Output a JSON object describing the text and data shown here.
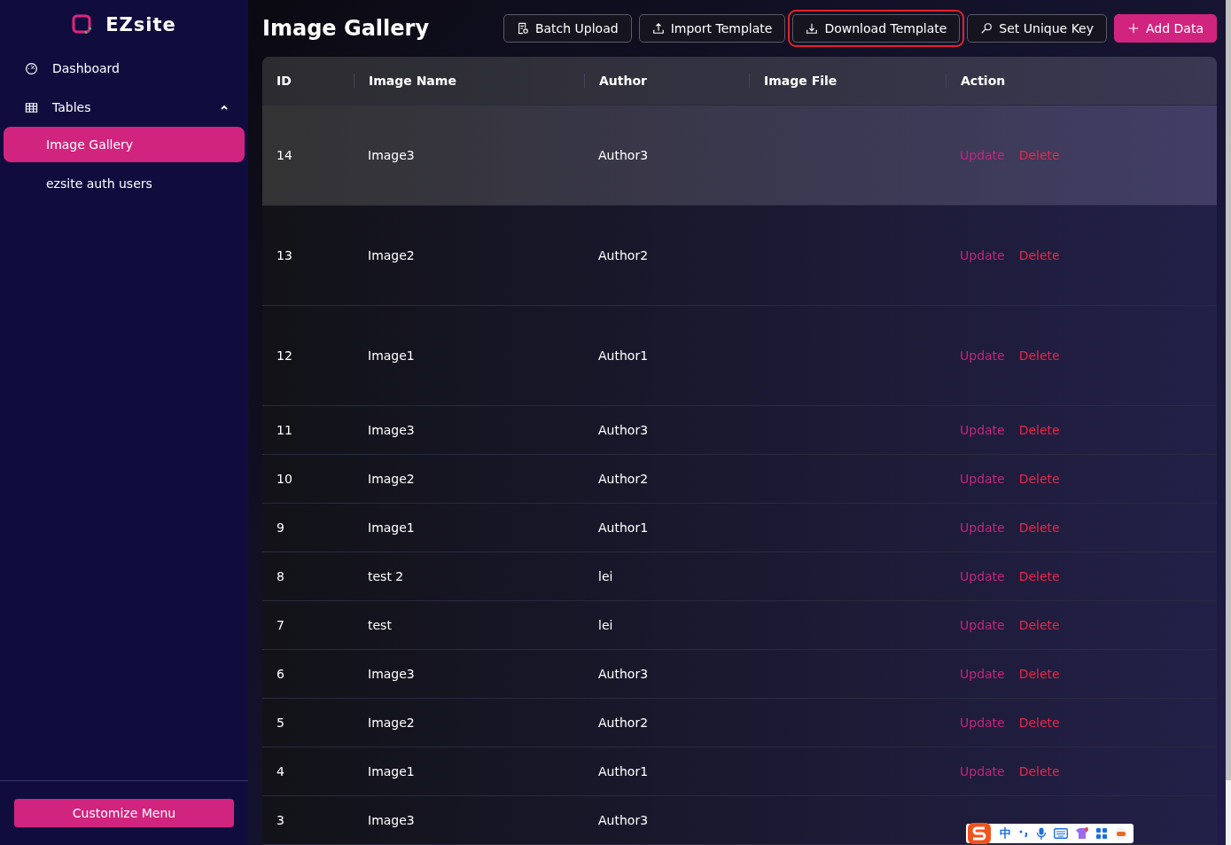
{
  "sidebar": {
    "logo": "EZsite",
    "items": [
      {
        "label": "Dashboard",
        "kind": "gauge"
      },
      {
        "label": "Tables",
        "kind": "grid",
        "expanded": true,
        "children": [
          {
            "label": "Image Gallery",
            "selected": true
          },
          {
            "label": "ezsite auth users",
            "selected": false
          }
        ]
      }
    ],
    "footer_button": "Customize Menu"
  },
  "header": {
    "title": "Image Gallery",
    "buttons": [
      {
        "label": "Batch Upload",
        "kind": "doc",
        "primary": false,
        "outlined_red": false
      },
      {
        "label": "Import Template",
        "kind": "upload",
        "primary": false,
        "outlined_red": false
      },
      {
        "label": "Download Template",
        "kind": "download",
        "primary": false,
        "outlined_red": true
      },
      {
        "label": "Set Unique Key",
        "kind": "key",
        "primary": false,
        "outlined_red": false
      },
      {
        "label": "Add Data",
        "kind": "plus",
        "primary": true,
        "outlined_red": false
      }
    ]
  },
  "table": {
    "columns": [
      "ID",
      "Image Name",
      "Author",
      "Image File",
      "Action"
    ],
    "rows": [
      {
        "id": "14",
        "name": "Image3",
        "author": "Author3",
        "tall": true,
        "hovered": true,
        "actions": [
          "Update",
          "Delete"
        ]
      },
      {
        "id": "13",
        "name": "Image2",
        "author": "Author2",
        "tall": true,
        "hovered": false,
        "actions": [
          "Update",
          "Delete"
        ]
      },
      {
        "id": "12",
        "name": "Image1",
        "author": "Author1",
        "tall": true,
        "hovered": false,
        "actions": [
          "Update",
          "Delete"
        ]
      },
      {
        "id": "11",
        "name": "Image3",
        "author": "Author3",
        "tall": false,
        "hovered": false,
        "actions": [
          "Update",
          "Delete"
        ]
      },
      {
        "id": "10",
        "name": "Image2",
        "author": "Author2",
        "tall": false,
        "hovered": false,
        "actions": [
          "Update",
          "Delete"
        ]
      },
      {
        "id": "9",
        "name": "Image1",
        "author": "Author1",
        "tall": false,
        "hovered": false,
        "actions": [
          "Update",
          "Delete"
        ]
      },
      {
        "id": "8",
        "name": "test 2",
        "author": "lei",
        "tall": false,
        "hovered": false,
        "actions": [
          "Update",
          "Delete"
        ]
      },
      {
        "id": "7",
        "name": "test",
        "author": "lei",
        "tall": false,
        "hovered": false,
        "actions": [
          "Update",
          "Delete"
        ]
      },
      {
        "id": "6",
        "name": "Image3",
        "author": "Author3",
        "tall": false,
        "hovered": false,
        "actions": [
          "Update",
          "Delete"
        ]
      },
      {
        "id": "5",
        "name": "Image2",
        "author": "Author2",
        "tall": false,
        "hovered": false,
        "actions": [
          "Update",
          "Delete"
        ]
      },
      {
        "id": "4",
        "name": "Image1",
        "author": "Author1",
        "tall": false,
        "hovered": false,
        "actions": [
          "Update",
          "Delete"
        ]
      },
      {
        "id": "3",
        "name": "Image3",
        "author": "Author3",
        "tall": false,
        "hovered": false
      }
    ]
  },
  "ime_toolbar": {
    "mode": "中"
  }
}
